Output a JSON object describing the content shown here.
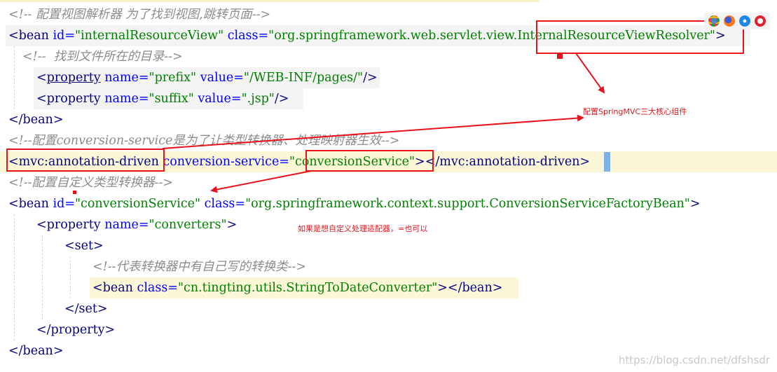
{
  "code": {
    "line1_comment": "<!-- 配置视图解析器 为了找到视图,跳转页面-->",
    "line2": {
      "open": "<",
      "tag": "bean",
      "attr1": "id=",
      "val1": "\"internalResourceView\"",
      "attr2": "class=",
      "val2_prefix": "\"org.springframework.web.servlet.view.",
      "val2_highlight": "InternalResourceViewResolver\"",
      "close": ">"
    },
    "line3_comment": "<!--  找到文件所在的目录-->",
    "line4": {
      "open": "<",
      "tag": "property",
      "attr1": "name=",
      "val1": "\"prefix\"",
      "attr2": "value=",
      "val2": "\"/WEB-INF/pages/\"",
      "close": "/>"
    },
    "line5": {
      "open": "<",
      "tag": "property",
      "attr1": "name=",
      "val1": "\"suffix\"",
      "attr2": "value=",
      "val2": "\".jsp\"",
      "close": "/>"
    },
    "line6": "</bean>",
    "line7_comment": "<!--配置conversion-service是为了让类型转换器、处理映射器生效-->",
    "line8": {
      "open": "<",
      "tag": "mvc:annotation-driven",
      "attr1": "conversion-service=",
      "val1_quote": "\"",
      "val1_highlight": "conversionService\"",
      "mid": "></",
      "end_tag": "mvc:annotation-driven",
      "close": ">"
    },
    "line9_comment": "<!--配置自定义类型转换器-->",
    "line10": {
      "open": "<",
      "tag": "bean",
      "attr1": "id=",
      "val1": "\"conversionService\"",
      "attr2": "class=",
      "val2": "\"org.springframework.context.support.ConversionServiceFactoryBean\"",
      "close": ">"
    },
    "line11": {
      "open": "<",
      "tag": "property",
      "attr1": "name=",
      "val1": "\"converters\"",
      "close": ">"
    },
    "line12": "<set>",
    "line13_comment": "<!--代表转换器中有自己写的转换类-->",
    "line14": {
      "open": "<",
      "tag": "bean",
      "attr1": "class=",
      "val1": "\"cn.tingting.utils.StringToDateConverter\"",
      "close": "></bean>"
    },
    "line15": "</set>",
    "line16": "</property>",
    "line17": "</bean>"
  },
  "annotations": {
    "note1": "配置SpringMVC三大核心组件",
    "note2": "如果是想自定义处理适配器，=也可以"
  },
  "browser_icons": [
    "chrome-icon",
    "firefox-icon",
    "safari-icon",
    "opera-icon"
  ],
  "watermark": "https://blog.csdn.net/dfshsdr",
  "colors": {
    "annotation_red": "#e8141b",
    "tag": "#000080",
    "attr": "#0000ff",
    "string": "#008000",
    "comment": "#8c8c8c"
  }
}
